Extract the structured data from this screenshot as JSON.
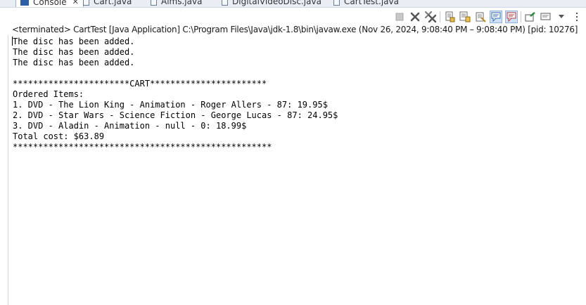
{
  "tabs": [
    {
      "label": "Console",
      "active": true,
      "icon": "console-icon"
    },
    {
      "label": "Cart.java",
      "icon": "java-file-icon"
    },
    {
      "label": "Aims.java",
      "icon": "java-file-icon"
    },
    {
      "label": "DigitalVideoDisc.java",
      "icon": "java-file-icon"
    },
    {
      "label": "CartTest.java",
      "icon": "java-file-icon"
    }
  ],
  "toolbar": {
    "buttons": [
      "terminate-icon",
      "remove-launch-icon",
      "remove-all-terminated-icon",
      "scroll-lock-icon",
      "word-wrap-icon",
      "show-console-output-icon",
      "show-console-error-icon",
      "pin-console-icon",
      "display-selected-console-icon",
      "open-console-icon",
      "view-menu-icon"
    ]
  },
  "status": "<terminated> CartTest [Java Application] C:\\Program Files\\Java\\jdk-1.8\\bin\\javaw.exe  (Nov 26, 2024, 9:08:40 PM – 9:08:40 PM) [pid: 10276]",
  "output": {
    "lines": [
      "The disc has been added.",
      "The disc has been added.",
      "The disc has been added.",
      "",
      "***********************CART***********************",
      "Ordered Items:",
      "1. DVD - The Lion King - Animation - Roger Allers - 87: 19.95$",
      "2. DVD - Star Wars - Science Fiction - George Lucas - 87: 24.95$",
      "3. DVD - Aladin - Animation - null - 0: 18.99$",
      "Total cost: $63.89",
      "***************************************************"
    ]
  },
  "colors": {
    "accent": "#2d5fa8",
    "terminate_red": "#c8c8c8",
    "selected_bg": "#cfe1f7"
  }
}
